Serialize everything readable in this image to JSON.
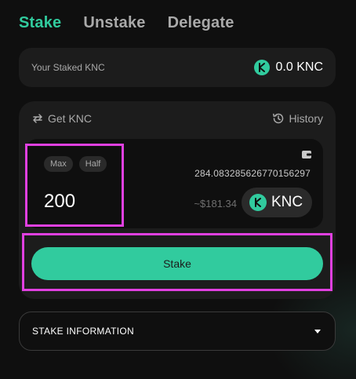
{
  "tabs": [
    {
      "label": "Stake",
      "active": true
    },
    {
      "label": "Unstake",
      "active": false
    },
    {
      "label": "Delegate",
      "active": false
    }
  ],
  "staked": {
    "label": "Your Staked KNC",
    "value": "0.0 KNC",
    "icon": "knc-logo-icon"
  },
  "panel": {
    "get_knc_label": "Get KNC",
    "history_label": "History",
    "max_label": "Max",
    "half_label": "Half",
    "amount": "200",
    "balance": "284.083285626770156297",
    "usd_value": "~$181.34",
    "token_symbol": "KNC",
    "stake_button_label": "Stake"
  },
  "info": {
    "label": "STAKE INFORMATION",
    "icon": "caret-down-icon"
  },
  "colors": {
    "accent": "#31cb9e",
    "background": "#0f0f0f",
    "card": "#1c1c1c",
    "highlight": "#e040e0"
  }
}
